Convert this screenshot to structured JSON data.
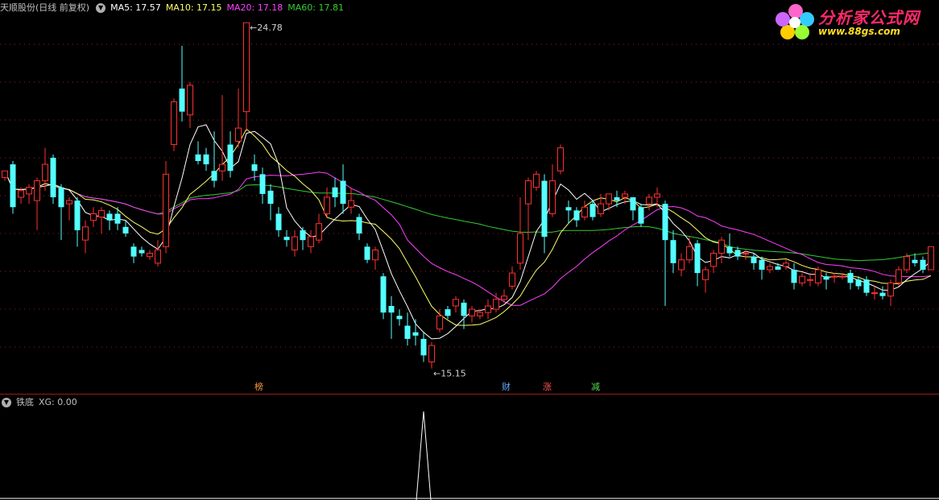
{
  "main_header": {
    "stock_name": "天顺股份(日线 前复权)",
    "ma5_label": "MA5: 17.57",
    "ma10_label": "MA10: 17.15",
    "ma20_label": "MA20: 17.18",
    "ma60_label": "MA60: 17.81"
  },
  "sub_header": {
    "indicator_name": "铁底",
    "xg_label": "XG: 0.00"
  },
  "logo": {
    "title": "分析家公式网",
    "url": "www.88gs.com"
  },
  "colors": {
    "up": "#ff3030",
    "down": "#54ffff",
    "ma5": "#ffffff",
    "ma10": "#ffff66",
    "ma20": "#ff40ff",
    "ma60": "#33cc33",
    "grid": "#9a1b1b"
  },
  "events": [
    {
      "label": "榜",
      "color": "#ff9944"
    },
    {
      "label": "财",
      "color": "#66aaff"
    },
    {
      "label": "涨",
      "color": "#ff5555"
    },
    {
      "label": "减",
      "color": "#55dd55"
    }
  ],
  "chart_data": {
    "type": "candlestick",
    "price_range": [
      14.0,
      25.0
    ],
    "high_label": "24.78",
    "low_label": "15.15",
    "candles": [
      [
        20.1,
        20.3,
        20.0,
        20.2
      ],
      [
        20.5,
        19.2,
        19.0,
        20.6
      ],
      [
        19.5,
        19.7,
        19.3,
        19.8
      ],
      [
        19.6,
        19.8,
        19.3,
        19.9
      ],
      [
        19.4,
        20.0,
        18.5,
        20.1
      ],
      [
        20.0,
        20.5,
        19.7,
        21.0
      ],
      [
        20.7,
        19.5,
        19.3,
        20.8
      ],
      [
        19.8,
        19.2,
        18.2,
        19.9
      ],
      [
        19.3,
        19.4,
        18.8,
        19.5
      ],
      [
        19.4,
        18.5,
        18.0,
        19.5
      ],
      [
        18.2,
        18.6,
        17.8,
        18.8
      ],
      [
        18.8,
        19.0,
        18.6,
        19.2
      ],
      [
        18.9,
        19.1,
        18.4,
        19.2
      ],
      [
        19.0,
        18.8,
        18.5,
        19.1
      ],
      [
        19.0,
        18.7,
        18.5,
        19.2
      ],
      [
        18.6,
        18.4,
        18.3,
        18.8
      ],
      [
        18.0,
        17.7,
        17.5,
        18.1
      ],
      [
        17.9,
        17.8,
        17.7,
        18.0
      ],
      [
        17.7,
        17.8,
        17.6,
        17.9
      ],
      [
        17.5,
        17.9,
        17.4,
        18.2
      ],
      [
        18.0,
        20.2,
        17.8,
        20.6
      ],
      [
        21.1,
        22.4,
        20.9,
        22.5
      ],
      [
        22.8,
        22.1,
        21.8,
        24.1
      ],
      [
        22.0,
        22.9,
        21.6,
        23.0
      ],
      [
        20.8,
        20.6,
        20.5,
        21.2
      ],
      [
        20.8,
        20.5,
        20.3,
        21.0
      ],
      [
        20.3,
        20.0,
        19.8,
        21.5
      ],
      [
        20.3,
        20.5,
        20.0,
        22.6
      ],
      [
        21.1,
        20.3,
        20.1,
        21.5
      ],
      [
        21.2,
        21.6,
        21.0,
        22.8
      ],
      [
        22.1,
        24.8,
        21.5,
        24.8
      ],
      [
        20.5,
        20.3,
        20.0,
        20.8
      ],
      [
        20.2,
        19.6,
        19.3,
        20.4
      ],
      [
        19.7,
        19.3,
        18.8,
        19.9
      ],
      [
        19.0,
        18.5,
        18.3,
        19.2
      ],
      [
        18.3,
        18.2,
        18.0,
        18.5
      ],
      [
        17.9,
        18.3,
        17.7,
        18.5
      ],
      [
        18.5,
        18.2,
        17.9,
        18.6
      ],
      [
        18.0,
        18.3,
        17.8,
        18.5
      ],
      [
        18.2,
        18.7,
        18.1,
        19.0
      ],
      [
        19.0,
        19.5,
        18.9,
        19.8
      ],
      [
        19.8,
        19.5,
        19.2,
        20.1
      ],
      [
        20.0,
        19.3,
        19.0,
        20.5
      ],
      [
        19.2,
        19.4,
        19.0,
        19.8
      ],
      [
        18.9,
        18.4,
        18.2,
        19.0
      ],
      [
        18.0,
        17.6,
        17.5,
        18.1
      ],
      [
        17.6,
        17.9,
        17.3,
        18.0
      ],
      [
        17.1,
        16.0,
        15.8,
        17.2
      ],
      [
        16.2,
        16.0,
        15.2,
        16.5
      ],
      [
        15.9,
        15.8,
        15.6,
        16.1
      ],
      [
        15.6,
        15.2,
        15.0,
        16.0
      ],
      [
        15.4,
        15.3,
        15.0,
        15.8
      ],
      [
        15.2,
        14.7,
        14.5,
        15.4
      ],
      [
        14.5,
        15.0,
        14.3,
        15.1
      ],
      [
        15.5,
        15.9,
        15.4,
        16.1
      ],
      [
        16.1,
        15.9,
        15.8,
        16.2
      ],
      [
        16.2,
        16.4,
        16.0,
        16.5
      ],
      [
        16.3,
        15.9,
        15.5,
        16.4
      ],
      [
        15.9,
        16.1,
        15.7,
        16.2
      ],
      [
        15.9,
        16.0,
        15.8,
        16.1
      ],
      [
        16.0,
        16.2,
        15.8,
        16.4
      ],
      [
        16.1,
        16.4,
        16.0,
        16.6
      ],
      [
        16.4,
        16.5,
        16.3,
        16.7
      ],
      [
        16.8,
        17.2,
        16.7,
        17.4
      ],
      [
        17.5,
        18.4,
        17.3,
        19.5
      ],
      [
        19.3,
        20.0,
        18.2,
        20.1
      ],
      [
        19.8,
        20.2,
        19.7,
        20.3
      ],
      [
        20.0,
        18.3,
        17.8,
        20.2
      ],
      [
        19.0,
        20.0,
        18.9,
        20.5
      ],
      [
        20.3,
        21.0,
        20.2,
        21.1
      ],
      [
        19.2,
        19.1,
        18.7,
        19.4
      ],
      [
        19.1,
        18.8,
        18.6,
        19.2
      ],
      [
        18.9,
        19.2,
        18.8,
        19.4
      ],
      [
        19.3,
        18.9,
        18.8,
        19.4
      ],
      [
        19.0,
        19.3,
        18.9,
        19.6
      ],
      [
        19.3,
        19.6,
        19.1,
        19.6
      ],
      [
        19.5,
        19.4,
        19.2,
        19.7
      ],
      [
        19.5,
        19.6,
        19.3,
        19.7
      ],
      [
        19.5,
        19.1,
        18.8,
        19.5
      ],
      [
        19.2,
        18.7,
        18.6,
        19.3
      ],
      [
        19.3,
        19.5,
        19.1,
        19.6
      ],
      [
        19.5,
        19.6,
        19.2,
        19.8
      ],
      [
        19.3,
        18.2,
        16.2,
        19.4
      ],
      [
        18.2,
        17.5,
        17.2,
        18.5
      ],
      [
        17.3,
        17.6,
        17.1,
        17.8
      ],
      [
        17.6,
        18.0,
        17.5,
        18.3
      ],
      [
        18.1,
        17.2,
        16.8,
        18.2
      ],
      [
        17.0,
        17.3,
        16.6,
        17.4
      ],
      [
        17.4,
        17.8,
        17.2,
        17.9
      ],
      [
        17.8,
        18.2,
        17.5,
        18.3
      ],
      [
        18.0,
        17.8,
        17.7,
        18.4
      ],
      [
        17.9,
        17.7,
        17.6,
        18.0
      ],
      [
        17.8,
        17.8,
        17.6,
        17.9
      ],
      [
        17.7,
        17.5,
        17.3,
        17.8
      ],
      [
        17.6,
        17.3,
        17.0,
        17.7
      ],
      [
        17.3,
        17.4,
        17.2,
        17.5
      ],
      [
        17.4,
        17.3,
        17.3,
        17.5
      ],
      [
        17.4,
        17.5,
        17.3,
        17.6
      ],
      [
        17.3,
        16.9,
        16.7,
        17.5
      ],
      [
        16.9,
        17.1,
        16.8,
        17.2
      ],
      [
        17.0,
        17.0,
        16.8,
        17.2
      ],
      [
        16.9,
        17.3,
        16.8,
        17.4
      ],
      [
        17.1,
        17.0,
        16.7,
        17.2
      ],
      [
        17.1,
        17.1,
        16.9,
        17.2
      ],
      [
        17.1,
        17.1,
        17.0,
        17.2
      ],
      [
        17.2,
        16.9,
        16.7,
        17.3
      ],
      [
        17.0,
        16.8,
        16.7,
        17.1
      ],
      [
        17.0,
        16.6,
        16.5,
        17.1
      ],
      [
        16.6,
        16.6,
        16.4,
        16.8
      ],
      [
        16.6,
        16.5,
        16.4,
        16.8
      ],
      [
        16.5,
        16.9,
        16.2,
        17.0
      ],
      [
        16.9,
        17.3,
        16.8,
        17.4
      ],
      [
        17.3,
        17.7,
        17.2,
        17.8
      ],
      [
        17.6,
        17.5,
        17.4,
        17.8
      ],
      [
        17.6,
        17.3,
        17.2,
        17.7
      ],
      [
        17.3,
        18.0,
        17.3,
        18.0
      ]
    ],
    "xg_signal_index": 53,
    "ma_lines": [
      "MA5",
      "MA10",
      "MA20",
      "MA60"
    ]
  }
}
